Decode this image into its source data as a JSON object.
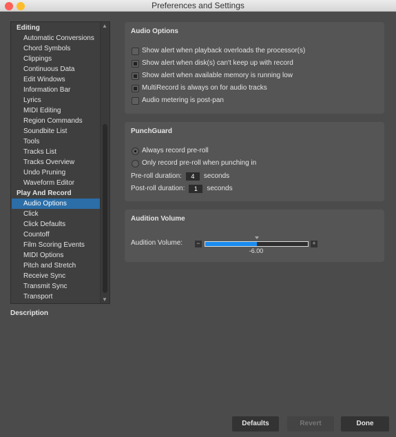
{
  "window": {
    "title": "Preferences and Settings"
  },
  "sidebar": {
    "items": [
      {
        "label": "Editing",
        "group": true
      },
      {
        "label": "Automatic Conversions"
      },
      {
        "label": "Chord Symbols"
      },
      {
        "label": "Clippings"
      },
      {
        "label": "Continuous Data"
      },
      {
        "label": "Edit Windows"
      },
      {
        "label": "Information Bar"
      },
      {
        "label": "Lyrics"
      },
      {
        "label": "MIDI Editing"
      },
      {
        "label": "Region Commands"
      },
      {
        "label": "Soundbite List"
      },
      {
        "label": "Tools"
      },
      {
        "label": "Tracks List"
      },
      {
        "label": "Tracks Overview"
      },
      {
        "label": "Undo Pruning"
      },
      {
        "label": "Waveform Editor"
      },
      {
        "label": "Play And Record",
        "group": true
      },
      {
        "label": "Audio Options",
        "selected": true
      },
      {
        "label": "Click"
      },
      {
        "label": "Click Defaults"
      },
      {
        "label": "Countoff"
      },
      {
        "label": "Film Scoring Events"
      },
      {
        "label": "MIDI Options"
      },
      {
        "label": "Pitch and Stretch"
      },
      {
        "label": "Receive Sync"
      },
      {
        "label": "Transmit Sync"
      },
      {
        "label": "Transport"
      }
    ],
    "description_label": "Description"
  },
  "audio_options": {
    "title": "Audio Options",
    "checkboxes": [
      {
        "label": "Show alert when playback overloads the processor(s)",
        "checked": false
      },
      {
        "label": "Show alert when disk(s) can't keep up with record",
        "checked": true
      },
      {
        "label": "Show alert when available memory is running low",
        "checked": true
      },
      {
        "label": "MultiRecord is always on for audio tracks",
        "checked": true
      },
      {
        "label": "Audio metering is post-pan",
        "checked": false
      }
    ]
  },
  "punchguard": {
    "title": "PunchGuard",
    "radios": [
      {
        "label": "Always record pre-roll",
        "selected": true
      },
      {
        "label": "Only record pre-roll when punching in",
        "selected": false
      }
    ],
    "preroll_label": "Pre-roll duration:",
    "preroll_value": "4",
    "postroll_label": "Post-roll duration:",
    "postroll_value": "1",
    "unit": "seconds"
  },
  "audition": {
    "title": "Audition Volume",
    "label": "Audition Volume:",
    "value": "-6.00",
    "fill_fraction": 0.5,
    "fill_color": "#1a8cf0"
  },
  "buttons": {
    "defaults": "Defaults",
    "revert": "Revert",
    "done": "Done"
  }
}
